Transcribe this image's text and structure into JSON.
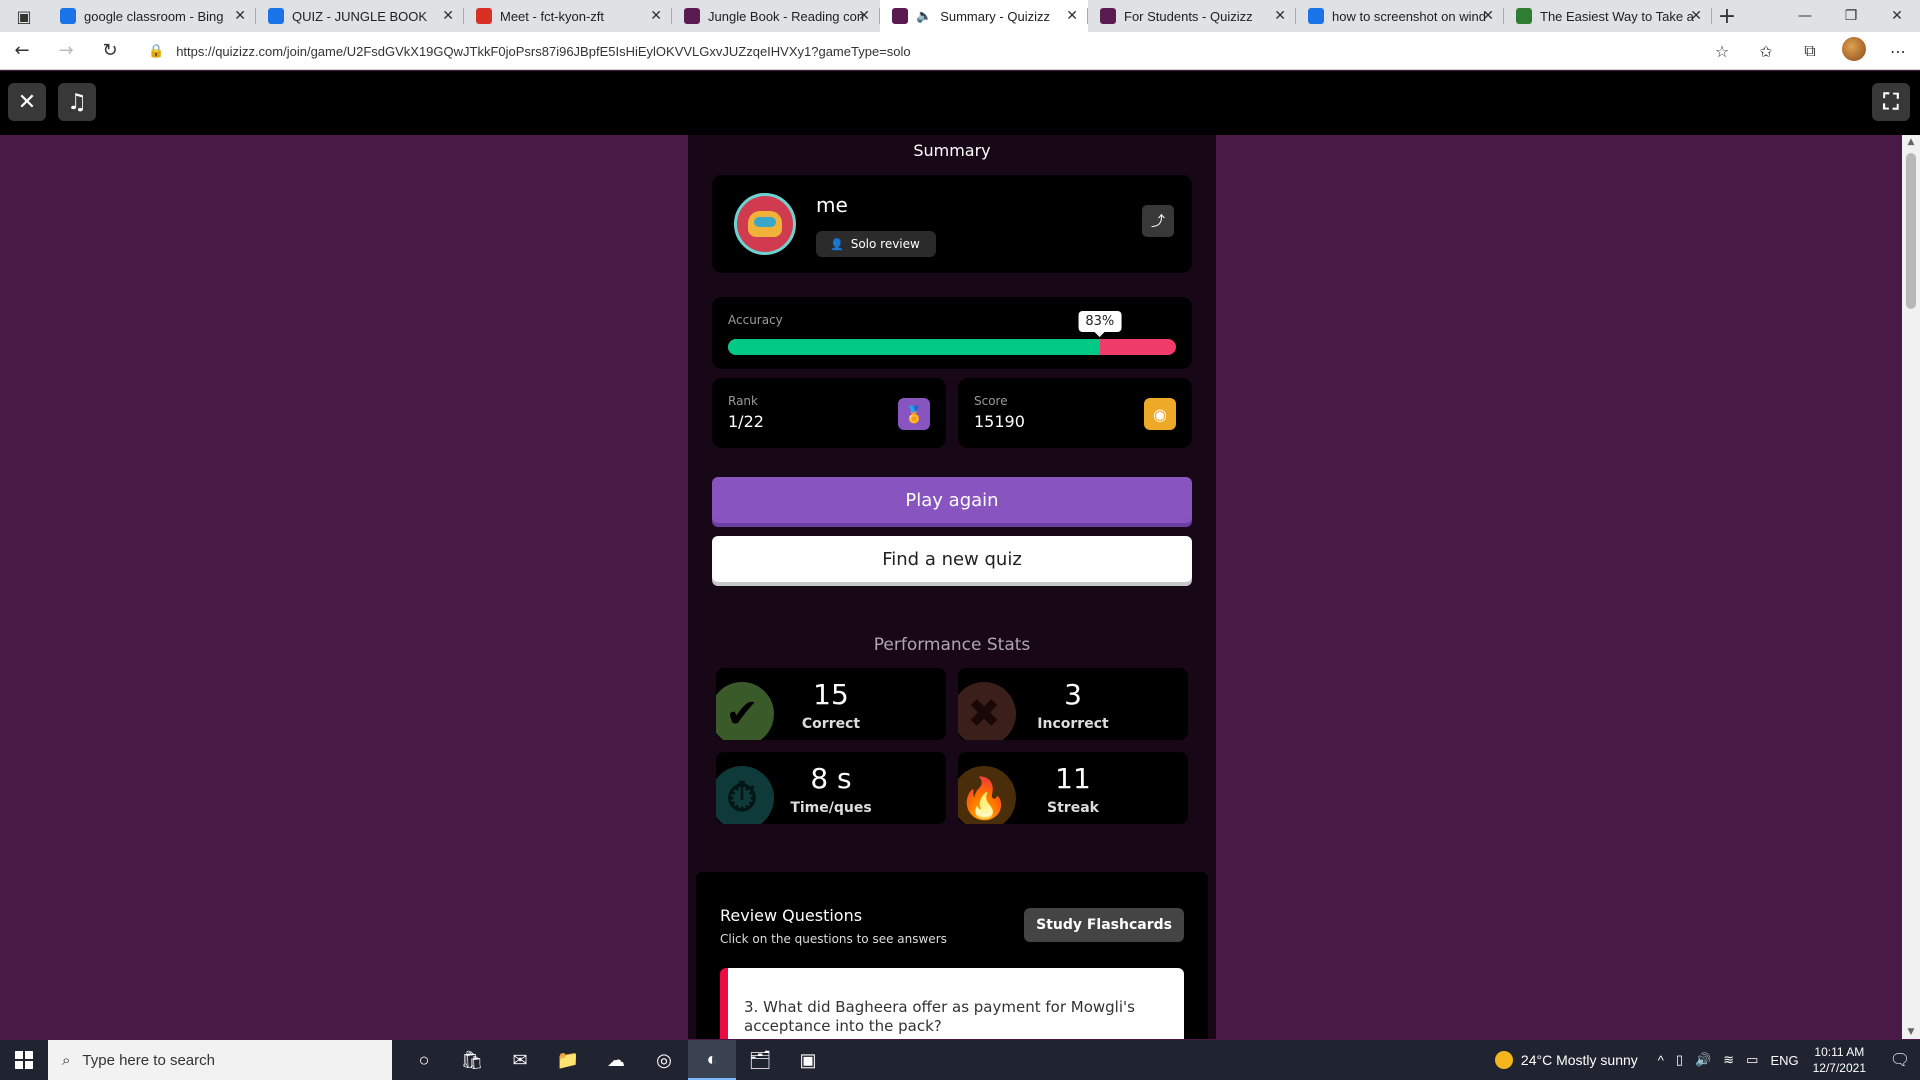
{
  "browser": {
    "tabs": [
      {
        "title": "google classroom - Bing",
        "favicon": "bing-icon",
        "color": "#1a73e8",
        "active": false
      },
      {
        "title": "QUIZ - JUNGLE BOOK",
        "favicon": "forms-icon",
        "color": "#1a73e8",
        "active": false
      },
      {
        "title": "Meet - fct-kyon-zft",
        "favicon": "recording-icon",
        "color": "#d93025",
        "active": false
      },
      {
        "title": "Jungle Book - Reading con",
        "favicon": "quizizz-icon",
        "color": "#5a1a52",
        "active": false
      },
      {
        "title": "Summary - Quizizz",
        "favicon": "quizizz-icon",
        "color": "#5a1a52",
        "active": true
      },
      {
        "title": "For Students - Quizizz",
        "favicon": "quizizz-icon",
        "color": "#5a1a52",
        "active": false
      },
      {
        "title": "how to screenshot on wind",
        "favicon": "bing-icon",
        "color": "#1a73e8",
        "active": false
      },
      {
        "title": "The Easiest Way to Take a",
        "favicon": "site-icon",
        "color": "#2e7d32",
        "active": false
      }
    ],
    "url": "https://quizizz.com/join/game/U2FsdGVkX19GQwJTkkF0joPsrs87i96JBpfE5IsHiEylOKVVLGxvJUZzqeIHVXy1?gameType=solo"
  },
  "quiz": {
    "summary_title": "Summary",
    "player_name": "me",
    "mode_label": "Solo review",
    "accuracy_label": "Accuracy",
    "accuracy_value": "83%",
    "accuracy_fraction": 0.83,
    "rank_label": "Rank",
    "rank_value": "1/22",
    "score_label": "Score",
    "score_value": "15190",
    "play_again_label": "Play again",
    "find_quiz_label": "Find a new quiz",
    "performance_title": "Performance Stats",
    "performance": [
      {
        "value": "15",
        "label": "Correct",
        "icon": "check-icon",
        "color": "#3b5a2a"
      },
      {
        "value": "3",
        "label": "Incorrect",
        "icon": "cross-icon",
        "color": "#3a1f1a"
      },
      {
        "value": "8 s",
        "label": "Time/ques",
        "icon": "stopwatch-icon",
        "color": "#0e3b3a"
      },
      {
        "value": "11",
        "label": "Streak",
        "icon": "flame-icon",
        "color": "#4a2e0a"
      }
    ],
    "review_title": "Review Questions",
    "review_subtitle": "Click on the questions to see answers",
    "flashcards_label": "Study Flashcards",
    "question_text": "3.   What did Bagheera offer as payment for Mowgli's acceptance into the pack?"
  },
  "taskbar": {
    "search_placeholder": "Type here to search",
    "weather": "24°C  Mostly sunny",
    "language": "ENG",
    "time": "10:11 AM",
    "date": "12/7/2021"
  }
}
